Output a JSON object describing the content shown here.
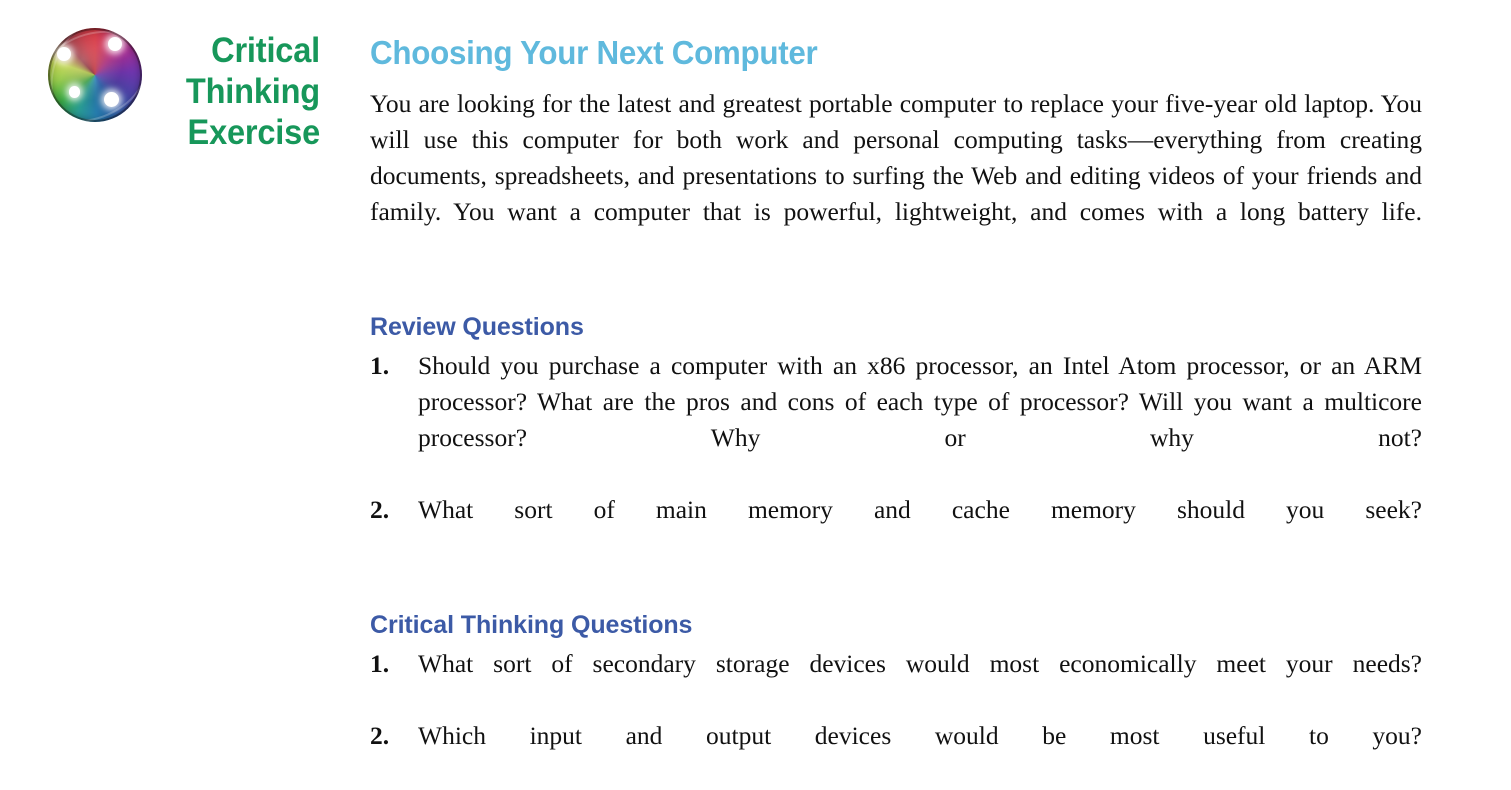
{
  "label": {
    "logo_icon": "rainbow-sphere-icon",
    "lines": [
      "Critical",
      "Thinking",
      "Exercise"
    ],
    "color": "#17975a"
  },
  "exercise": {
    "title": "Choosing Your Next Computer",
    "title_color": "#5fb9dd",
    "intro": "You are looking for the latest and greatest portable computer to replace your five-year old laptop. You will use this computer for both work and personal computing tasks—everything from creating documents, spreadsheets, and presentations to surfing the Web and editing videos of your friends and family. You want a computer that is powerful, lightweight, and comes with a long battery life."
  },
  "sections": [
    {
      "heading": "Review Questions",
      "heading_color": "#3c5aa6",
      "questions": [
        {
          "number": "1.",
          "text": "Should you purchase a computer with an x86 processor, an Intel Atom processor, or an ARM processor? What are the pros and cons of each type of processor? Will you want a multicore processor? Why or why not?"
        },
        {
          "number": "2.",
          "text": "What sort of main memory and cache memory should you seek?"
        }
      ]
    },
    {
      "heading": "Critical Thinking Questions",
      "heading_color": "#3c5aa6",
      "questions": [
        {
          "number": "1.",
          "text": "What sort of secondary storage devices would most economically meet your needs?"
        },
        {
          "number": "2.",
          "text": "Which input and output devices would be most useful to you?"
        }
      ]
    }
  ]
}
